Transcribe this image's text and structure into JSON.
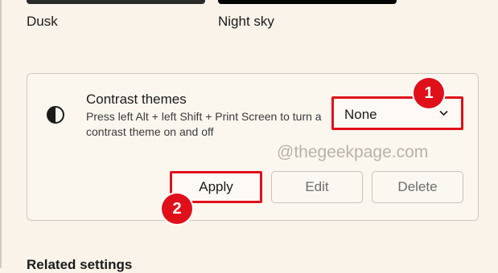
{
  "themes": [
    {
      "label": "Dusk"
    },
    {
      "label": "Night sky"
    }
  ],
  "contrast": {
    "icon": "contrast-icon",
    "title": "Contrast themes",
    "description": "Press left Alt + left Shift + Print Screen to turn a contrast theme on and off",
    "dropdown": {
      "value": "None",
      "icon": "chevron-down-icon"
    }
  },
  "buttons": {
    "apply": "Apply",
    "edit": "Edit",
    "delete": "Delete"
  },
  "annotations": {
    "badge1": "1",
    "badge2": "2",
    "highlight_color": "#e0101a"
  },
  "watermark": "@thegeekpage.com",
  "related": "Related settings"
}
